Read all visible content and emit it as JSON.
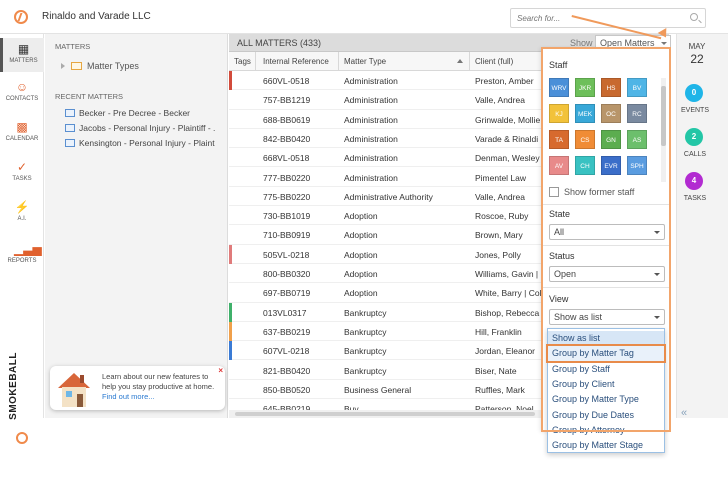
{
  "header": {
    "firm_name": "Rinaldo and Varade LLC",
    "search_placeholder": "Search for..."
  },
  "nav": [
    {
      "label": "MATTERS",
      "icon": "matters-icon"
    },
    {
      "label": "CONTACTS",
      "icon": "contacts-icon"
    },
    {
      "label": "CALENDAR",
      "icon": "calendar-icon"
    },
    {
      "label": "TASKS",
      "icon": "tasks-icon"
    },
    {
      "label": "A.I.",
      "icon": "ai-bolt-icon"
    },
    {
      "label": "REPORTS",
      "icon": "reports-icon"
    }
  ],
  "brand": "SMOKEBALL",
  "sidepanel": {
    "matters_heading": "MATTERS",
    "matter_types_label": "Matter Types",
    "recent_heading": "RECENT MATTERS",
    "recent": [
      "Becker - Pre Decree - Becker",
      "Jacobs - Personal Injury - Plaintiff - .",
      "Kensington - Personal Injury - Plaint"
    ]
  },
  "promo": {
    "text": "Learn about our new features to help you stay productive at home.",
    "link": "Find out more...",
    "close": "×"
  },
  "list": {
    "title": "ALL MATTERS (433)",
    "show_label": "Show",
    "show_value": "Open Matters",
    "columns": [
      "Tags",
      "Internal Reference",
      "Matter Type",
      "Client (full)"
    ],
    "rows": [
      {
        "tag": "#d24b3b",
        "ref": "660VL-0518",
        "type": "Administration",
        "client": "Preston, Amber"
      },
      {
        "tag": "",
        "ref": "757-BB1219",
        "type": "Administration",
        "client": "Valle, Andrea"
      },
      {
        "tag": "",
        "ref": "688-BB0619",
        "type": "Administration",
        "client": "Grinwalde, Mollie"
      },
      {
        "tag": "",
        "ref": "842-BB0420",
        "type": "Administration",
        "client": "Varade & Rinaldi"
      },
      {
        "tag": "",
        "ref": "668VL-0518",
        "type": "Administration",
        "client": "Denman, Wesley"
      },
      {
        "tag": "",
        "ref": "777-BB0220",
        "type": "Administration",
        "client": "Pimentel Law"
      },
      {
        "tag": "",
        "ref": "775-BB0220",
        "type": "Administrative Authority",
        "client": "Valle, Andrea"
      },
      {
        "tag": "",
        "ref": "730-BB1019",
        "type": "Adoption",
        "client": "Roscoe, Ruby"
      },
      {
        "tag": "",
        "ref": "710-BB0919",
        "type": "Adoption",
        "client": "Brown, Mary"
      },
      {
        "tag": "#e07b7b",
        "ref": "505VL-0218",
        "type": "Adoption",
        "client": "Jones, Polly"
      },
      {
        "tag": "",
        "ref": "800-BB0320",
        "type": "Adoption",
        "client": "Williams, Gavin | F"
      },
      {
        "tag": "",
        "ref": "697-BB0719",
        "type": "Adoption",
        "client": "White, Barry | Coll"
      },
      {
        "tag": "#3fb06a",
        "ref": "013VL0317",
        "type": "Bankruptcy",
        "client": "Bishop, Rebecca |"
      },
      {
        "tag": "#f0a04b",
        "ref": "637-BB0219",
        "type": "Bankruptcy",
        "client": "Hill, Franklin"
      },
      {
        "tag": "#3a7bd5",
        "ref": "607VL-0218",
        "type": "Bankruptcy",
        "client": "Jordan, Eleanor"
      },
      {
        "tag": "",
        "ref": "821-BB0420",
        "type": "Bankruptcy",
        "client": "Biser, Nate"
      },
      {
        "tag": "",
        "ref": "850-BB0520",
        "type": "Business General",
        "client": "Ruffles, Mark"
      },
      {
        "tag": "",
        "ref": "645-BB0219",
        "type": "Buy",
        "client": "Patterson, Noel"
      }
    ]
  },
  "filters": {
    "staff_label": "Staff",
    "staff": [
      {
        "initials": "WRV",
        "color": "#4a8fd8"
      },
      {
        "initials": "JKR",
        "color": "#6dbf5a"
      },
      {
        "initials": "HS",
        "color": "#c8692f"
      },
      {
        "initials": "BV",
        "color": "#4fb5e6"
      },
      {
        "initials": "KJ",
        "color": "#f2c23a"
      },
      {
        "initials": "MEK",
        "color": "#38a8d8"
      },
      {
        "initials": "OC",
        "color": "#b8956a"
      },
      {
        "initials": "RC",
        "color": "#7a8aa0"
      },
      {
        "initials": "TA",
        "color": "#d76a2e"
      },
      {
        "initials": "CS",
        "color": "#f08c36"
      },
      {
        "initials": "GN",
        "color": "#5cad4f"
      },
      {
        "initials": "AS",
        "color": "#6cbf6c"
      },
      {
        "initials": "AV",
        "color": "#e88a8a"
      },
      {
        "initials": "CH",
        "color": "#39c2c2"
      },
      {
        "initials": "EVR",
        "color": "#3b6ec9"
      },
      {
        "initials": "SPH",
        "color": "#5a9ce0"
      }
    ],
    "show_former": "Show former staff",
    "state_label": "State",
    "state_value": "All",
    "status_label": "Status",
    "status_value": "Open",
    "view_label": "View",
    "view_value": "Show as list",
    "view_options": [
      "Show as list",
      "Group by Matter Tag",
      "Group by Staff",
      "Group by Client",
      "Group by Matter Type",
      "Group by Due Dates",
      "Group by Attorney",
      "Group by Matter Stage"
    ]
  },
  "rail": {
    "month": "MAY",
    "day": "22",
    "events_count": "0",
    "events_label": "EVENTS",
    "calls_count": "2",
    "calls_label": "CALLS",
    "tasks_count": "4",
    "tasks_label": "TASKS",
    "collapse": "«"
  },
  "colors": {
    "accent": "#e0612e",
    "events_badge": "#1fb5e8",
    "calls_badge": "#23c6a6",
    "tasks_badge": "#b22bd1",
    "annotation": "#f09a5b"
  }
}
